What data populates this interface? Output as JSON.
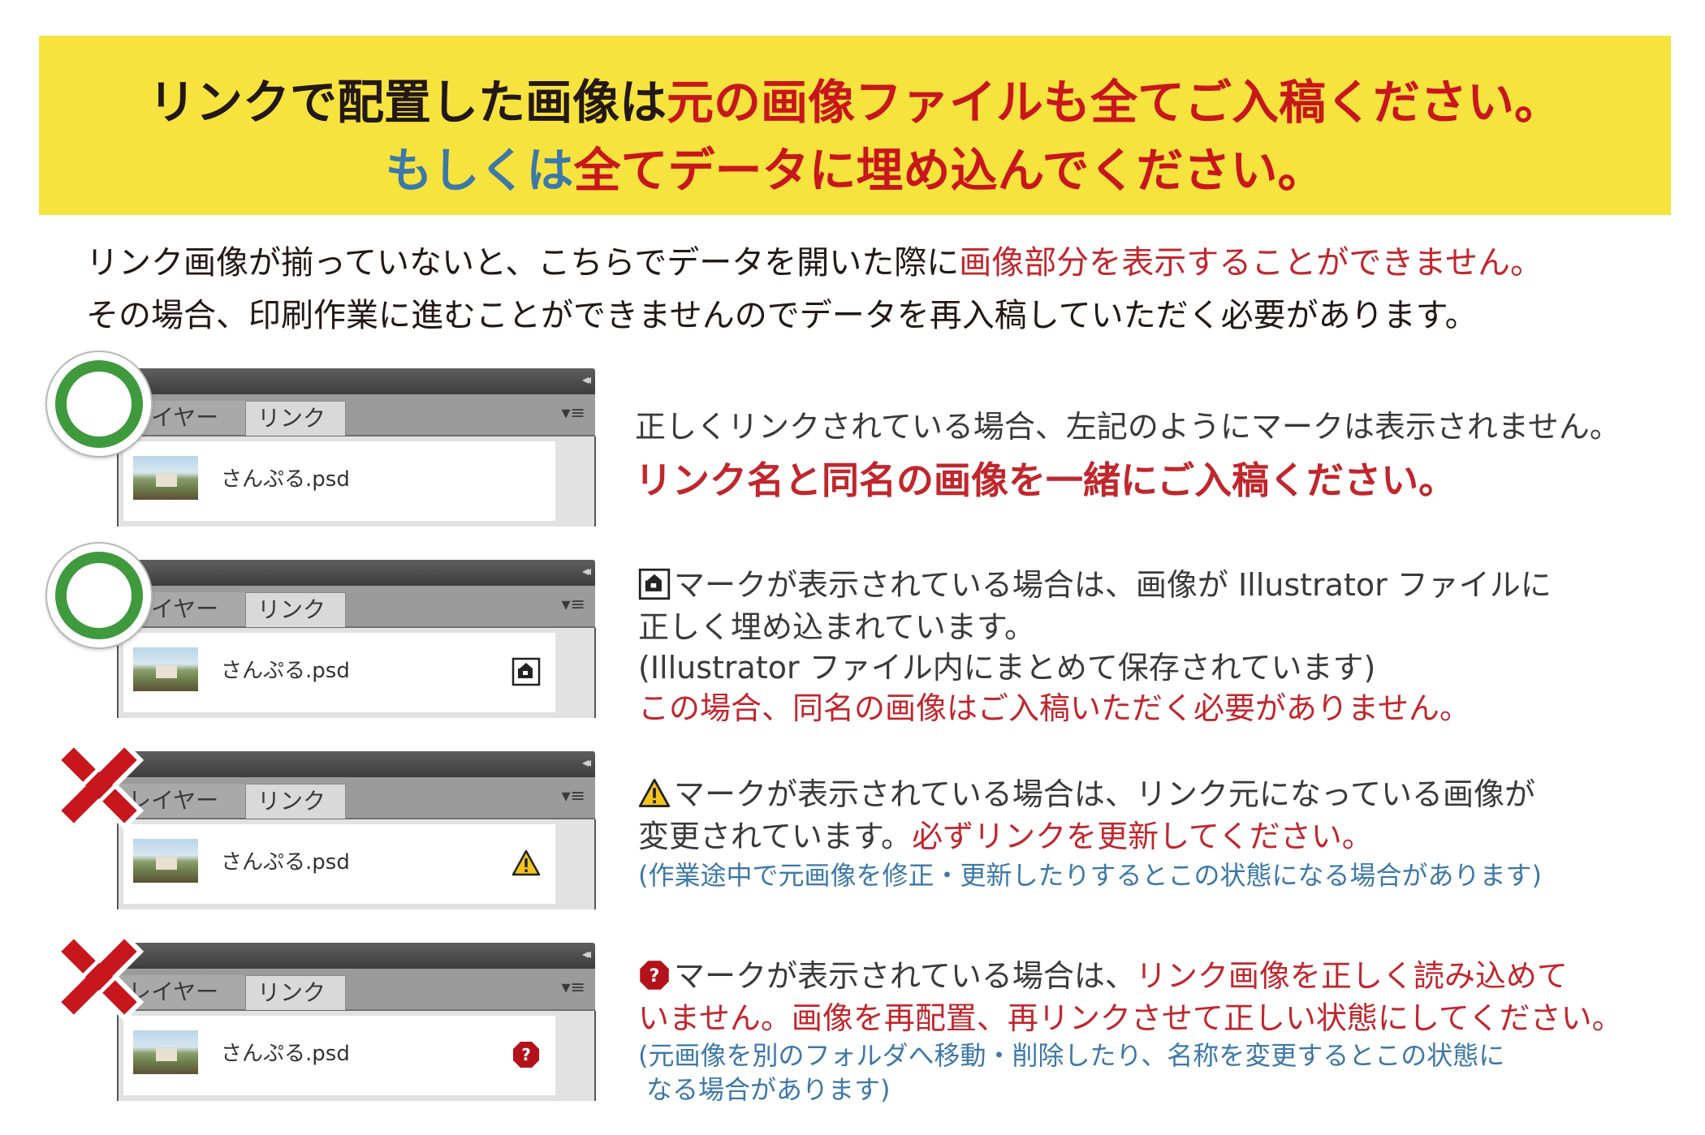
{
  "banner": {
    "line1_black": "リンクで配置した画像は",
    "line1_red": "元の画像ファイルも全てご入稿ください。",
    "line2_blue": "もしくは",
    "line2_red": "全てデータに埋め込んでください。"
  },
  "intro": {
    "line1_black": "リンク画像が揃っていないと、こちらでデータを開いた際に",
    "line1_red": "画像部分を表示することができません。",
    "line2": "その場合、印刷作業に進むことができませんのでデータを再入稿していただく必要があります。"
  },
  "panel_labels": {
    "tab_layer": "レイヤー",
    "tab_link": "リンク",
    "collapse": "◂◂",
    "menu": "▾≡",
    "file_name": "さんぷる.psd"
  },
  "colors": {
    "banner_bg": "#f7e33e",
    "red": "#c0272d",
    "blue": "#3c78a8",
    "ok_green": "#3f9a3d",
    "ng_red": "#c8161d"
  },
  "cases": [
    {
      "mark": "ok",
      "icon": "none",
      "line1": "正しくリンクされている場合、左記のようにマークは表示されません。",
      "line2_big_red": "リンク名と同名の画像を一緒にご入稿ください。"
    },
    {
      "mark": "ok",
      "icon": "embedded-icon",
      "line1": "マークが表示されている場合は、画像が Illustrator ファイルに",
      "line2": "正しく埋め込まれています。",
      "line3": "(Illustrator ファイル内にまとめて保存されています)",
      "line4_red": "この場合、同名の画像はご入稿いただく必要がありません。"
    },
    {
      "mark": "ng",
      "icon": "warning-icon",
      "line1": "マークが表示されている場合は、リンク元になっている画像が",
      "line2_black": "変更されています。",
      "line2_red": "必ずリンクを更新してください。",
      "line3_blue": "(作業途中で元画像を修正・更新したりするとこの状態になる場合があります)"
    },
    {
      "mark": "ng",
      "icon": "missing-icon",
      "line1_black": "マークが表示されている場合は、",
      "line1_red": "リンク画像を正しく読み込めて",
      "line2_red": "いません。画像を再配置、再リンクさせて正しい状態にしてください。",
      "line3_blue": "(元画像を別のフォルダへ移動・削除したり、名称を変更するとこの状態に",
      "line4_blue": "なる場合があります)"
    }
  ]
}
